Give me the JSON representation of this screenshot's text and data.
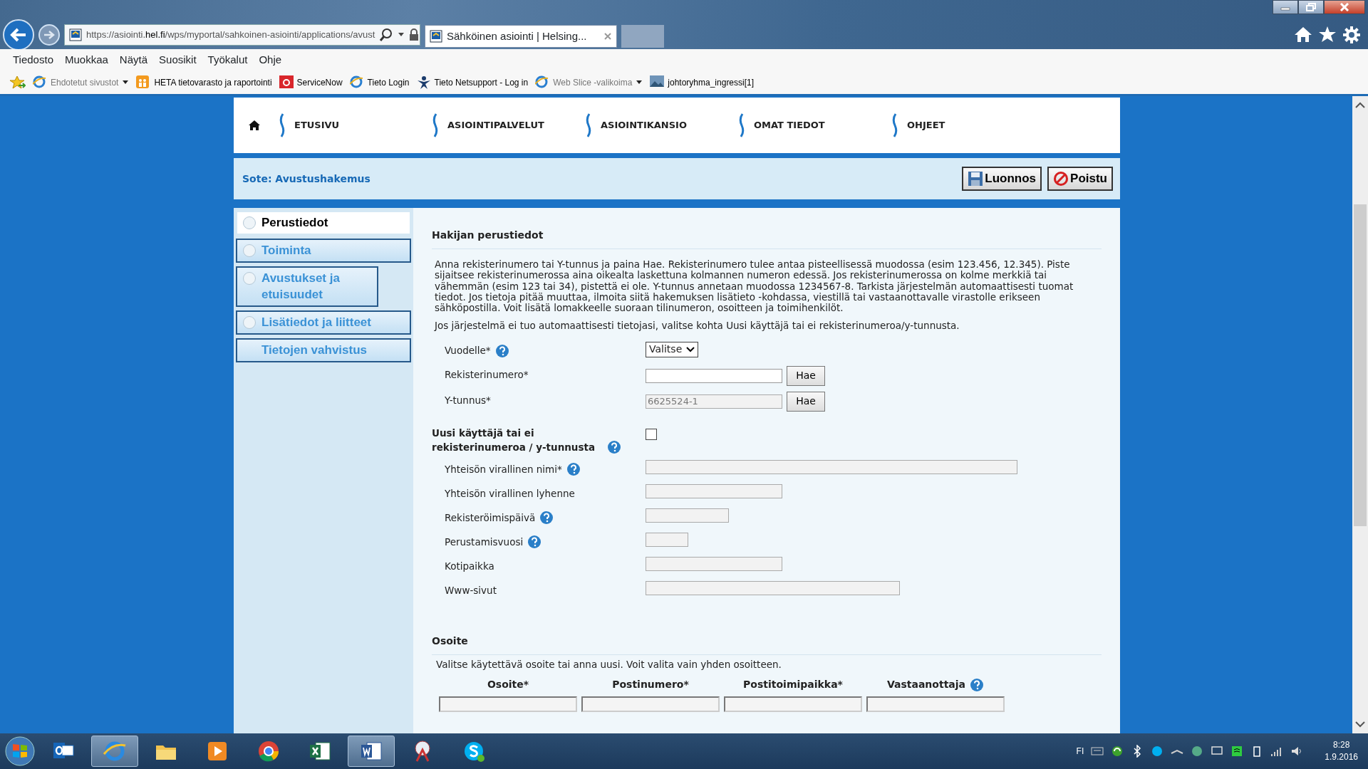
{
  "browser": {
    "address": "https://asiointi.**hel.fi**/wps/myportal/sahkoinen-asiointi/applications/avust",
    "tab": "Sähköinen asiointi | Helsing...",
    "menu": [
      "Tiedosto",
      "Muokkaa",
      "Näytä",
      "Suosikit",
      "Työkalut",
      "Ohje"
    ],
    "favorites": [
      {
        "kind": "ie",
        "label": "Ehdotetut sivustot",
        "dimmed": true,
        "dropdown": true
      },
      {
        "kind": "people",
        "label": "HETA tietovarasto ja raportointi",
        "dimmed": false,
        "dropdown": false
      },
      {
        "kind": "servicenow",
        "label": "ServiceNow",
        "dimmed": false,
        "dropdown": false
      },
      {
        "kind": "ie",
        "label": "Tieto Login",
        "dimmed": false,
        "dropdown": false
      },
      {
        "kind": "person",
        "label": "Tieto Netsupport - Log in",
        "dimmed": false,
        "dropdown": false
      },
      {
        "kind": "ie",
        "label": "Web Slice -valikoima",
        "dimmed": true,
        "dropdown": true
      },
      {
        "kind": "image",
        "label": "johtoryhma_ingressi[1]",
        "dimmed": false,
        "dropdown": false
      }
    ]
  },
  "nav": [
    "ETUSIVU",
    "ASIOINTIPALVELUT",
    "ASIOINTIKANSIO",
    "OMAT TIEDOT",
    "OHJEET"
  ],
  "page_title": "Sote: Avustushakemus",
  "actions": [
    {
      "kind": "save",
      "label": "Luonnos"
    },
    {
      "kind": "exit",
      "label": "Poistu"
    }
  ],
  "steps": [
    {
      "label": "Perustiedot",
      "selected": true,
      "radio": true
    },
    {
      "label": "Toiminta",
      "selected": false,
      "radio": true
    },
    {
      "label": "Avustukset ja etuisuudet",
      "selected": false,
      "radio": true
    },
    {
      "label": "Lisätiedot ja liitteet",
      "selected": false,
      "radio": true
    },
    {
      "label": "Tietojen vahvistus",
      "selected": false,
      "radio": false
    }
  ],
  "form": {
    "title": "Hakijan perustiedot",
    "intro": " Anna rekisterinumero tai Y-tunnus ja paina Hae. Rekisterinumero tulee antaa pisteellisessä muodossa (esim 123.456, 12.345). Piste sijaitsee rekisterinumerossa aina oikealta laskettuna kolmannen numeron edessä. Jos rekisterinumerossa on kolme merkkiä tai vähemmän (esim 123 tai 34), pistettä ei ole. Y-tunnus annetaan muodossa 1234567-8. Tarkista järjestelmän automaattisesti tuomat tiedot. Jos tietoja pitää muuttaa, ilmoita siitä hakemuksen lisätieto -kohdassa, viestillä tai vastaanottavalle virastolle erikseen sähköpostilla. Voit lisätä lomakkeelle suoraan tilinumeron, osoitteen ja toimihenkilöt.",
    "note": "Jos järjestelmä ei tuo automaattisesti tietojasi, valitse kohta Uusi käyttäjä tai ei rekisterinumeroa/y-tunnusta.",
    "fields": [
      {
        "kind": "select",
        "label": "Vuodelle*",
        "help": true,
        "value": "Valitse"
      },
      {
        "kind": "lookup",
        "label": "Rekisterinumero*",
        "help": false,
        "disabled": false,
        "button": "Hae"
      },
      {
        "kind": "lookup",
        "label": "Y-tunnus*",
        "help": false,
        "value": "6625524-1",
        "disabled": true,
        "button": "Hae"
      },
      {
        "kind": "checkbox",
        "label": "Uusi käyttäjä tai ei rekisterinumeroa / y-tunnusta",
        "help": true,
        "checked": false
      },
      {
        "kind": "text",
        "label": "Yhteisön virallinen nimi*",
        "help": true,
        "disabled": true
      },
      {
        "kind": "text",
        "label": "Yhteisön virallinen lyhenne",
        "help": false,
        "disabled": true
      },
      {
        "kind": "text",
        "label": "Rekisteröimispäivä",
        "help": true,
        "disabled": true
      },
      {
        "kind": "text",
        "label": "Perustamisvuosi",
        "help": true,
        "disabled": true
      },
      {
        "kind": "text",
        "label": "Kotipaikka",
        "help": false,
        "disabled": true
      },
      {
        "kind": "text",
        "label": "Www-sivut",
        "help": false,
        "disabled": true
      }
    ],
    "address": {
      "title": "Osoite",
      "note": "Valitse käytettävä osoite tai anna uusi. Voit valita vain yhden osoitteen.",
      "columns": [
        {
          "label": "Osoite*",
          "help": false
        },
        {
          "label": "Postinumero*",
          "help": false
        },
        {
          "label": "Postitoimipaikka*",
          "help": false
        },
        {
          "label": "Vastaanottaja",
          "help": true
        }
      ]
    }
  },
  "taskbar": {
    "apps": [
      {
        "kind": "outlook",
        "selected": false
      },
      {
        "kind": "ie",
        "selected": true
      },
      {
        "kind": "folder",
        "selected": false
      },
      {
        "kind": "media",
        "selected": false
      },
      {
        "kind": "chrome",
        "selected": false
      },
      {
        "kind": "excel",
        "selected": false
      },
      {
        "kind": "word",
        "selected": true
      },
      {
        "kind": "snip",
        "selected": false
      },
      {
        "kind": "skype",
        "selected": false
      }
    ],
    "language": "FI",
    "time": "8:28",
    "date": "1.9.2016"
  }
}
